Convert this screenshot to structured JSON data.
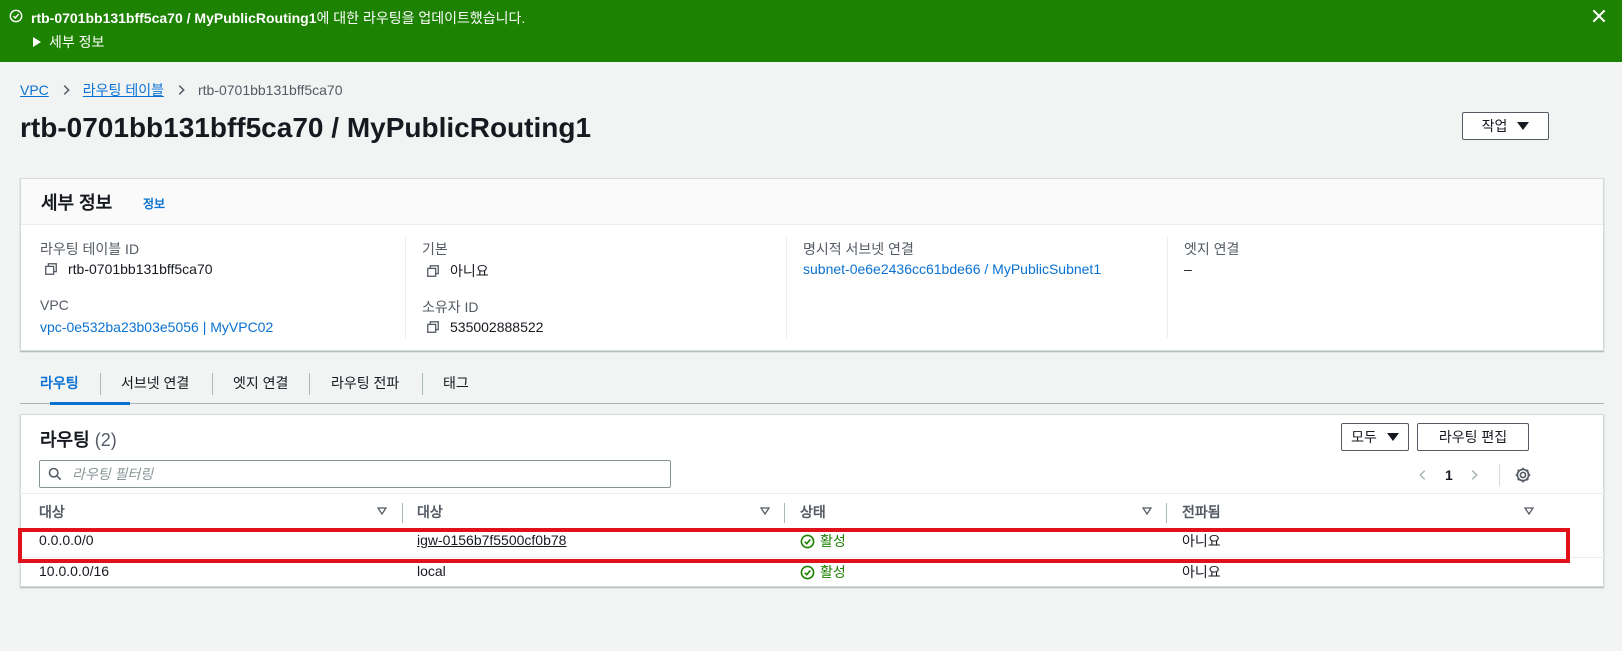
{
  "flash": {
    "resource": "rtb-0701bb131bff5ca70 / MyPublicRouting1",
    "message_suffix": "에 대한 라우팅을 업데이트했습니다.",
    "details_label": "세부 정보"
  },
  "breadcrumbs": {
    "vpc": "VPC",
    "route_tables": "라우팅 테이블",
    "current": "rtb-0701bb131bff5ca70"
  },
  "page": {
    "title": "rtb-0701bb131bff5ca70 / MyPublicRouting1",
    "actions_label": "작업"
  },
  "details": {
    "heading": "세부 정보",
    "info_label": "정보",
    "route_table_id_label": "라우팅 테이블 ID",
    "route_table_id": "rtb-0701bb131bff5ca70",
    "main_label": "기본",
    "main_value": "아니요",
    "explicit_subnet_label": "명시적 서브넷 연결",
    "explicit_subnet_value": "subnet-0e6e2436cc61bde66 / MyPublicSubnet1",
    "edge_label": "엣지 연결",
    "edge_value": "–",
    "vpc_label": "VPC",
    "vpc_value": "vpc-0e532ba23b03e5056 | MyVPC02",
    "owner_label": "소유자 ID",
    "owner_value": "535002888522"
  },
  "tabs": [
    "라우팅",
    "서브넷 연결",
    "엣지 연결",
    "라우팅 전파",
    "태그"
  ],
  "routes": {
    "title": "라우팅",
    "count": "(2)",
    "filter_label": "모두",
    "edit_label": "라우팅 편집",
    "search_placeholder": "라우팅 필터링",
    "page_number": "1",
    "columns": [
      "대상",
      "대상",
      "상태",
      "전파됨"
    ],
    "rows": [
      {
        "destination": "0.0.0.0/0",
        "target": "igw-0156b7f5500cf0b78",
        "status": "활성",
        "propagated": "아니요"
      },
      {
        "destination": "10.0.0.0/16",
        "target": "local",
        "status": "활성",
        "propagated": "아니요"
      }
    ]
  },
  "colors": {
    "flash_success": "#1d8102",
    "link": "#0972d3",
    "highlight": "#e0111b"
  }
}
